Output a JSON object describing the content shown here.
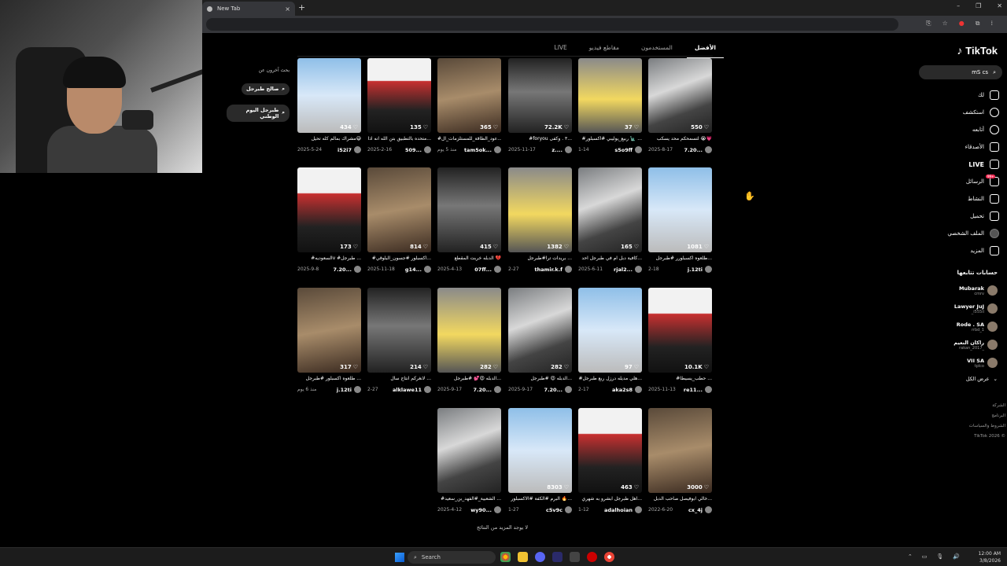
{
  "browser": {
    "tab_title": "New Tab",
    "tab_close": "×",
    "new_tab": "+",
    "win_controls": [
      "–",
      "❐",
      "✕"
    ],
    "toolbar_icons": [
      "⎘",
      "☆",
      "●",
      "⧉",
      "⁞"
    ]
  },
  "tiktok": {
    "logo": "TikTok",
    "search_query": "mS cs",
    "tabs": [
      "الأفضل",
      "المستخدمون",
      "مقاطع فيديو",
      "LIVE"
    ],
    "nav": [
      {
        "label": "لك",
        "icon": "home-icon",
        "bold": false
      },
      {
        "label": "استكشف",
        "icon": "compass-icon",
        "bold": false
      },
      {
        "label": "أتابعه",
        "icon": "following-icon",
        "bold": false
      },
      {
        "label": "الأصدقاء",
        "icon": "friends-icon",
        "bold": false
      },
      {
        "label": "LIVE",
        "icon": "live-icon",
        "bold": true
      },
      {
        "label": "الرسائل",
        "icon": "messages-icon",
        "bold": false,
        "badge": "99+"
      },
      {
        "label": "النشاط",
        "icon": "activity-icon",
        "bold": false
      },
      {
        "label": "تحميل",
        "icon": "upload-icon",
        "bold": false
      },
      {
        "label": "الملف الشخصي",
        "icon": "profile-icon",
        "bold": false
      },
      {
        "label": "المزيد",
        "icon": "more-icon",
        "bold": false
      }
    ],
    "following_title": "حسابات تتابعها",
    "following": [
      {
        "name": "Mubarak",
        "handle": "cmrv"
      },
      {
        "name": "Lawyer JuJ",
        "handle": "_i555il"
      },
      {
        "name": "Rode . SA",
        "handle": "rrbd_1"
      },
      {
        "name": "راكان النعيم",
        "handle": "rakan_2017_"
      },
      {
        "name": "VII SA",
        "handle": "tplco"
      }
    ],
    "show_all": "عرض الكل",
    "footer": [
      "الشركة",
      "البرنامج",
      "الشروط والسياسات",
      "TikTok 2026 ©"
    ],
    "related_title": "بحث آخرون عن",
    "related": [
      "صالح طبرجل",
      "طبرجل اليوم الوطني"
    ],
    "end_text": "لا يوجد المزيد من النتائج",
    "videos": [
      {
        "likes": "550",
        "caption": "لتسمحكم محد يسكب 😭💗",
        "date": "2025-8-17",
        "user": "7.20..."
      },
      {
        "likes": "37",
        "caption": "#ربيع_يوليبي #اكسبلور 🗽 ...",
        "date": "1-14",
        "user": "s5o9ff"
      },
      {
        "likes": "72.2K",
        "caption": "#foryou ٣ . وكفى...",
        "date": "2025-11-17",
        "user": "z...."
      },
      {
        "likes": "365",
        "caption": "#عود_الطاقة_للمستلزمات_ال...",
        "date": "منذ 5 يوم",
        "user": "tam5ok..."
      },
      {
        "likes": "135",
        "caption": "متحده بالتطبيق بتن الله انه اذا...",
        "date": "2025-2-16",
        "user": "509..."
      },
      {
        "likes": "434",
        "caption": "مشراك بمالم كله تحيل😅",
        "date": "2025-5-24",
        "user": "i52i7"
      },
      {
        "likes": "1081",
        "caption": "طلعوه اكسبلورر #طبرجل...",
        "date": "2-18",
        "user": "j.12ti"
      },
      {
        "likes": "165",
        "caption": "كافية دبل ام في طبرجل احد...",
        "date": "2025-6-11",
        "user": "rjal2..."
      },
      {
        "likes": "1382",
        "caption": "بريدات ترا#طبرجل ...",
        "date": "2-27",
        "user": "thamir.k.f"
      },
      {
        "likes": "415",
        "caption": "الدبله خربت المقطع 💔",
        "date": "2025-4-13",
        "user": "07ff..."
      },
      {
        "likes": "814",
        "caption": "#اكسبلور #جسون_البلوقي...",
        "date": "2025-11-18",
        "user": "g14..."
      },
      {
        "likes": "173",
        "caption": "#السعوديهv #طبرجل ...",
        "date": "2025-9-8",
        "user": "7.20..."
      },
      {
        "likes": "10.1K",
        "caption": "#حطب_يسيطا ...",
        "date": "2025-11-13",
        "user": "re11..."
      },
      {
        "likes": "97",
        "caption": "#هلي مديله درزل ربع طبرجل...",
        "date": "2-17",
        "user": "aka2s8"
      },
      {
        "likes": "282",
        "caption": "الدبله 😍 #طبرجل...",
        "date": "2025-9-17",
        "user": "7.20..."
      },
      {
        "likes": "282",
        "caption": "الدبله 😍💕 #طبرجل...",
        "date": "2025-9-17",
        "user": "7.20..."
      },
      {
        "likes": "214",
        "caption": "لانغركم انتاج سال ...",
        "date": "2-27",
        "user": "alklawe11"
      },
      {
        "likes": "317",
        "caption": "طلعوه اكسبلور #طبرجل ...",
        "date": "منذ 6 يوم",
        "user": "j.12ti"
      },
      {
        "likes": "3000",
        "caption": "خالي ابوفيصل صاحب الدبل...",
        "date": "2022-6-20",
        "user": "cx_4j"
      },
      {
        "likes": "463",
        "caption": "اهل طبرجل ابشرو به شهري...",
        "date": "1-12",
        "user": "adalhoian"
      },
      {
        "likes": "8303",
        "caption": "البرم #الكفة #الاكسبلور 🔥...",
        "date": "1-27",
        "user": "c5v9c"
      },
      {
        "likes": "",
        "caption": "#الشعبية_#الفهد_بن_سعيد ...",
        "date": "2025-4-12",
        "user": "wy90..."
      }
    ]
  },
  "taskbar": {
    "search_placeholder": "Search",
    "time": "12:00 AM",
    "date": "3/8/2026"
  }
}
